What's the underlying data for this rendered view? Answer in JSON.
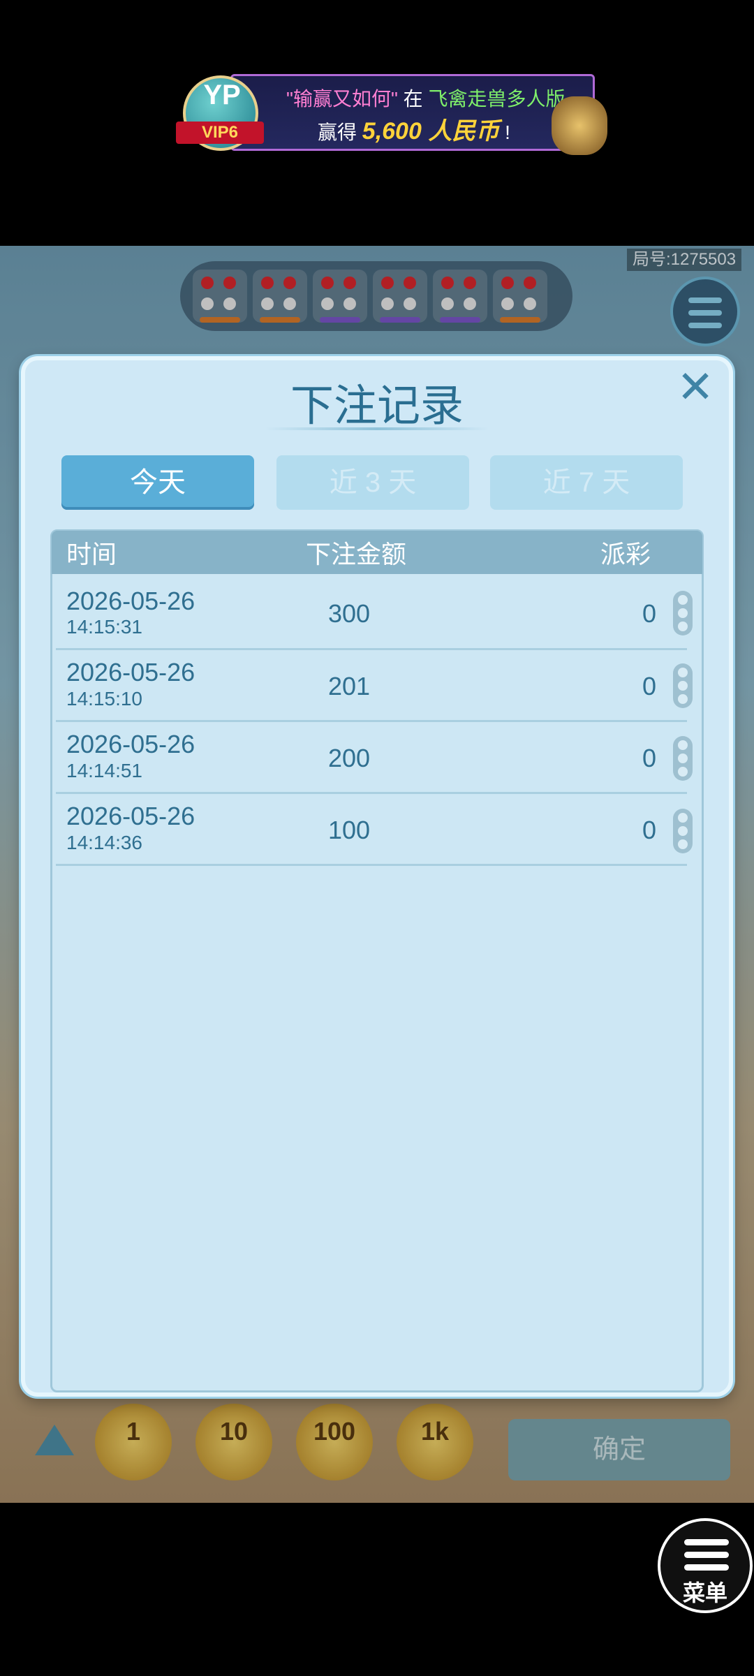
{
  "banner": {
    "quote_text": "\"输赢又如何\"",
    "mid_text": "在",
    "game_name": "飞禽走兽多人版",
    "win_prefix": "赢得",
    "amount": "5,600 人民币",
    "suffix": "!",
    "vip_logo": "YP",
    "vip_level": "VIP6"
  },
  "game": {
    "round_label": "局号:1275503",
    "confirm_label": "确定",
    "chips": [
      "1",
      "10",
      "100",
      "1k"
    ]
  },
  "modal": {
    "title": "下注记录",
    "close_icon": "close-icon",
    "tabs": [
      "今天",
      "近 3 天",
      "近 7 天"
    ],
    "active_tab": "今天",
    "columns": [
      "时间",
      "下注金额",
      "派彩"
    ],
    "rows": [
      {
        "date": "2026-05-26",
        "time": "14:15:31",
        "amount": "300",
        "payout": "0"
      },
      {
        "date": "2026-05-26",
        "time": "14:15:10",
        "amount": "201",
        "payout": "0"
      },
      {
        "date": "2026-05-26",
        "time": "14:14:51",
        "amount": "200",
        "payout": "0"
      },
      {
        "date": "2026-05-26",
        "time": "14:14:36",
        "amount": "100",
        "payout": "0"
      }
    ]
  },
  "float_menu": {
    "label": "菜单",
    "icon": "hamburger-icon"
  },
  "colors": {
    "accent": "#5aaed8",
    "modal_bg": "#cfe8f6",
    "header": "#87b3c8",
    "text": "#2f6f90"
  }
}
